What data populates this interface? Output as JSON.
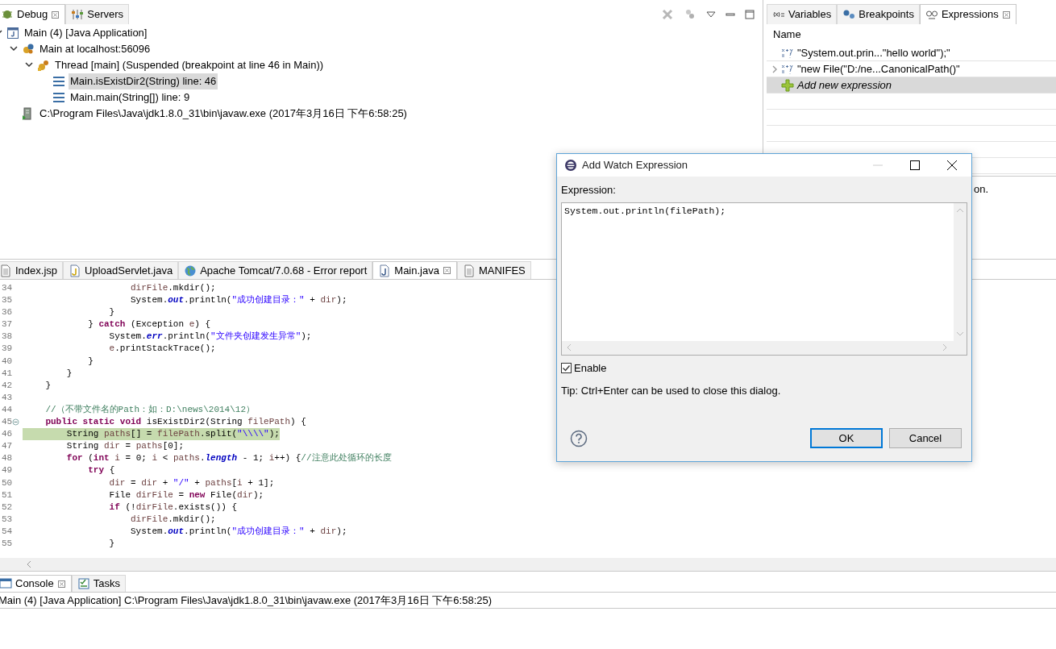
{
  "debug_view": {
    "tabs": [
      {
        "label": "Debug",
        "selected": true,
        "closable": true
      },
      {
        "label": "Servers",
        "selected": false,
        "closable": false
      }
    ],
    "tree": [
      {
        "label": "Main (4) [Java Application]",
        "kind": "launch",
        "expanded": true,
        "selected": false,
        "children": [
          {
            "label": "Main at localhost:56096",
            "kind": "target",
            "expanded": true,
            "selected": false,
            "children": [
              {
                "label": "Thread [main] (Suspended (breakpoint at line 46 in Main))",
                "kind": "thread",
                "expanded": true,
                "selected": false,
                "children": [
                  {
                    "label": "Main.isExistDir2(String) line: 46",
                    "kind": "frame",
                    "selected": true
                  },
                  {
                    "label": "Main.main(String[]) line: 9",
                    "kind": "frame",
                    "selected": false
                  }
                ]
              }
            ]
          },
          {
            "label": "C:\\Program Files\\Java\\jdk1.8.0_31\\bin\\javaw.exe (2017年3月16日 下午6:58:25)",
            "kind": "process",
            "selected": false
          }
        ]
      }
    ]
  },
  "expressions_view": {
    "tabs": [
      {
        "label": "Variables",
        "selected": false,
        "closable": false
      },
      {
        "label": "Breakpoints",
        "selected": false,
        "closable": false
      },
      {
        "label": "Expressions",
        "selected": true,
        "closable": true
      }
    ],
    "column": "Name",
    "rows": [
      {
        "label": "\"System.out.prin...\"hello world\");\"",
        "kind": "expression",
        "expandable": false,
        "selected": false
      },
      {
        "label": "\"new File(\"D:/ne...CanonicalPath()\"",
        "kind": "expression",
        "expandable": true,
        "selected": false
      },
      {
        "label": "Add new expression",
        "kind": "add",
        "expandable": false,
        "selected": true
      }
    ],
    "detail_text": "on."
  },
  "editor": {
    "tabs": [
      {
        "label": "Index.jsp",
        "selected": false,
        "closable": false
      },
      {
        "label": "UploadServlet.java",
        "selected": false,
        "closable": false
      },
      {
        "label": "Apache Tomcat/7.0.68 - Error report",
        "selected": false,
        "closable": false
      },
      {
        "label": "Main.java",
        "selected": true,
        "closable": true
      },
      {
        "label": "MANIFES",
        "selected": false,
        "closable": false
      }
    ],
    "lines": [
      {
        "number": "34",
        "highlighted": false,
        "fold": false,
        "segments": [
          {
            "kind": "var",
            "text": "                    dirFile"
          },
          {
            "kind": "plain",
            "text": ".mkdir();"
          }
        ]
      },
      {
        "number": "35",
        "highlighted": false,
        "fold": false,
        "segments": [
          {
            "kind": "plain",
            "text": "                    System."
          },
          {
            "kind": "field",
            "text": "out"
          },
          {
            "kind": "plain",
            "text": ".println("
          },
          {
            "kind": "string",
            "text": "\"成功创建目录：\""
          },
          {
            "kind": "plain",
            "text": " + "
          },
          {
            "kind": "var",
            "text": "dir"
          },
          {
            "kind": "plain",
            "text": ");"
          }
        ]
      },
      {
        "number": "36",
        "highlighted": false,
        "fold": false,
        "segments": [
          {
            "kind": "plain",
            "text": "                }"
          }
        ]
      },
      {
        "number": "37",
        "highlighted": false,
        "fold": false,
        "segments": [
          {
            "kind": "plain",
            "text": "            } "
          },
          {
            "kind": "keyword",
            "text": "catch"
          },
          {
            "kind": "plain",
            "text": " (Exception "
          },
          {
            "kind": "var",
            "text": "e"
          },
          {
            "kind": "plain",
            "text": ") {"
          }
        ]
      },
      {
        "number": "38",
        "highlighted": false,
        "fold": false,
        "segments": [
          {
            "kind": "plain",
            "text": "                System."
          },
          {
            "kind": "field",
            "text": "err"
          },
          {
            "kind": "plain",
            "text": ".println("
          },
          {
            "kind": "string",
            "text": "\"文件夹创建发生异常\""
          },
          {
            "kind": "plain",
            "text": ");"
          }
        ]
      },
      {
        "number": "39",
        "highlighted": false,
        "fold": false,
        "segments": [
          {
            "kind": "var",
            "text": "                e"
          },
          {
            "kind": "plain",
            "text": ".printStackTrace();"
          }
        ]
      },
      {
        "number": "40",
        "highlighted": false,
        "fold": false,
        "segments": [
          {
            "kind": "plain",
            "text": "            }"
          }
        ]
      },
      {
        "number": "41",
        "highlighted": false,
        "fold": false,
        "segments": [
          {
            "kind": "plain",
            "text": "        }"
          }
        ]
      },
      {
        "number": "42",
        "highlighted": false,
        "fold": false,
        "segments": [
          {
            "kind": "plain",
            "text": "    }"
          }
        ]
      },
      {
        "number": "43",
        "highlighted": false,
        "fold": false
      },
      {
        "number": "44",
        "highlighted": false,
        "fold": false,
        "segments": [
          {
            "kind": "comment",
            "text": "    //（不带文件名的Path：如：D:\\news\\2014\\12）"
          }
        ]
      },
      {
        "number": "45",
        "highlighted": false,
        "fold": true,
        "segments": [
          {
            "kind": "keyword",
            "text": "    public static void"
          },
          {
            "kind": "plain",
            "text": " isExistDir2(String "
          },
          {
            "kind": "var",
            "text": "filePath"
          },
          {
            "kind": "plain",
            "text": ") {"
          }
        ]
      },
      {
        "number": "46",
        "highlighted": true,
        "fold": false,
        "segments": [
          {
            "kind": "plain",
            "text": "        String "
          },
          {
            "kind": "var",
            "text": "paths"
          },
          {
            "kind": "plain",
            "text": "[] = "
          },
          {
            "kind": "var",
            "text": "filePath"
          },
          {
            "kind": "plain",
            "text": ".split("
          },
          {
            "kind": "string",
            "text": "\"\\\\\\\\\""
          },
          {
            "kind": "plain",
            "text": ");"
          }
        ]
      },
      {
        "number": "47",
        "highlighted": false,
        "fold": false,
        "segments": [
          {
            "kind": "plain",
            "text": "        String "
          },
          {
            "kind": "var",
            "text": "dir"
          },
          {
            "kind": "plain",
            "text": " = "
          },
          {
            "kind": "var",
            "text": "paths"
          },
          {
            "kind": "plain",
            "text": "[0];"
          }
        ]
      },
      {
        "number": "48",
        "highlighted": false,
        "fold": false,
        "segments": [
          {
            "kind": "keyword",
            "text": "        for"
          },
          {
            "kind": "plain",
            "text": " ("
          },
          {
            "kind": "keyword",
            "text": "int"
          },
          {
            "kind": "var",
            "text": " i"
          },
          {
            "kind": "plain",
            "text": " = 0; "
          },
          {
            "kind": "var",
            "text": "i"
          },
          {
            "kind": "plain",
            "text": " < "
          },
          {
            "kind": "var",
            "text": "paths"
          },
          {
            "kind": "plain",
            "text": "."
          },
          {
            "kind": "field",
            "text": "length"
          },
          {
            "kind": "plain",
            "text": " - 1; "
          },
          {
            "kind": "var",
            "text": "i"
          },
          {
            "kind": "plain",
            "text": "++) {"
          },
          {
            "kind": "comment",
            "text": "//注意此处循环的长度"
          }
        ]
      },
      {
        "number": "49",
        "highlighted": false,
        "fold": false,
        "segments": [
          {
            "kind": "keyword",
            "text": "            try"
          },
          {
            "kind": "plain",
            "text": " {"
          }
        ]
      },
      {
        "number": "50",
        "highlighted": false,
        "fold": false,
        "segments": [
          {
            "kind": "var",
            "text": "                dir"
          },
          {
            "kind": "plain",
            "text": " = "
          },
          {
            "kind": "var",
            "text": "dir"
          },
          {
            "kind": "plain",
            "text": " + "
          },
          {
            "kind": "string",
            "text": "\"/\""
          },
          {
            "kind": "plain",
            "text": " + "
          },
          {
            "kind": "var",
            "text": "paths"
          },
          {
            "kind": "plain",
            "text": "["
          },
          {
            "kind": "var",
            "text": "i"
          },
          {
            "kind": "plain",
            "text": " + 1];"
          }
        ]
      },
      {
        "number": "51",
        "highlighted": false,
        "fold": false,
        "segments": [
          {
            "kind": "plain",
            "text": "                File "
          },
          {
            "kind": "var",
            "text": "dirFile"
          },
          {
            "kind": "plain",
            "text": " = "
          },
          {
            "kind": "keyword",
            "text": "new"
          },
          {
            "kind": "plain",
            "text": " File("
          },
          {
            "kind": "var",
            "text": "dir"
          },
          {
            "kind": "plain",
            "text": ");"
          }
        ]
      },
      {
        "number": "52",
        "highlighted": false,
        "fold": false,
        "segments": [
          {
            "kind": "keyword",
            "text": "                if"
          },
          {
            "kind": "plain",
            "text": " (!"
          },
          {
            "kind": "var",
            "text": "dirFile"
          },
          {
            "kind": "plain",
            "text": ".exists()) {"
          }
        ]
      },
      {
        "number": "53",
        "highlighted": false,
        "fold": false,
        "segments": [
          {
            "kind": "var",
            "text": "                    dirFile"
          },
          {
            "kind": "plain",
            "text": ".mkdir();"
          }
        ]
      },
      {
        "number": "54",
        "highlighted": false,
        "fold": false,
        "segments": [
          {
            "kind": "plain",
            "text": "                    System."
          },
          {
            "kind": "field",
            "text": "out"
          },
          {
            "kind": "plain",
            "text": ".println("
          },
          {
            "kind": "string",
            "text": "\"成功创建目录：\""
          },
          {
            "kind": "plain",
            "text": " + "
          },
          {
            "kind": "var",
            "text": "dir"
          },
          {
            "kind": "plain",
            "text": ");"
          }
        ]
      },
      {
        "number": "55",
        "highlighted": false,
        "fold": false,
        "segments": [
          {
            "kind": "plain",
            "text": "                }"
          }
        ]
      }
    ]
  },
  "console": {
    "tabs": [
      {
        "label": "Console",
        "selected": true,
        "closable": true
      },
      {
        "label": "Tasks",
        "selected": false,
        "closable": false
      }
    ],
    "header": "Main (4) [Java Application] C:\\Program Files\\Java\\jdk1.8.0_31\\bin\\javaw.exe (2017年3月16日 下午6:58:25)"
  },
  "dialog": {
    "title": "Add Watch Expression",
    "expression_label": "Expression:",
    "expression_value": "System.out.println(filePath);",
    "enable": {
      "label": "Enable",
      "checked": true
    },
    "tip": "Tip: Ctrl+Enter can be used to close this dialog.",
    "buttons": [
      {
        "label": "OK",
        "default": true
      },
      {
        "label": "Cancel",
        "default": false
      }
    ]
  }
}
